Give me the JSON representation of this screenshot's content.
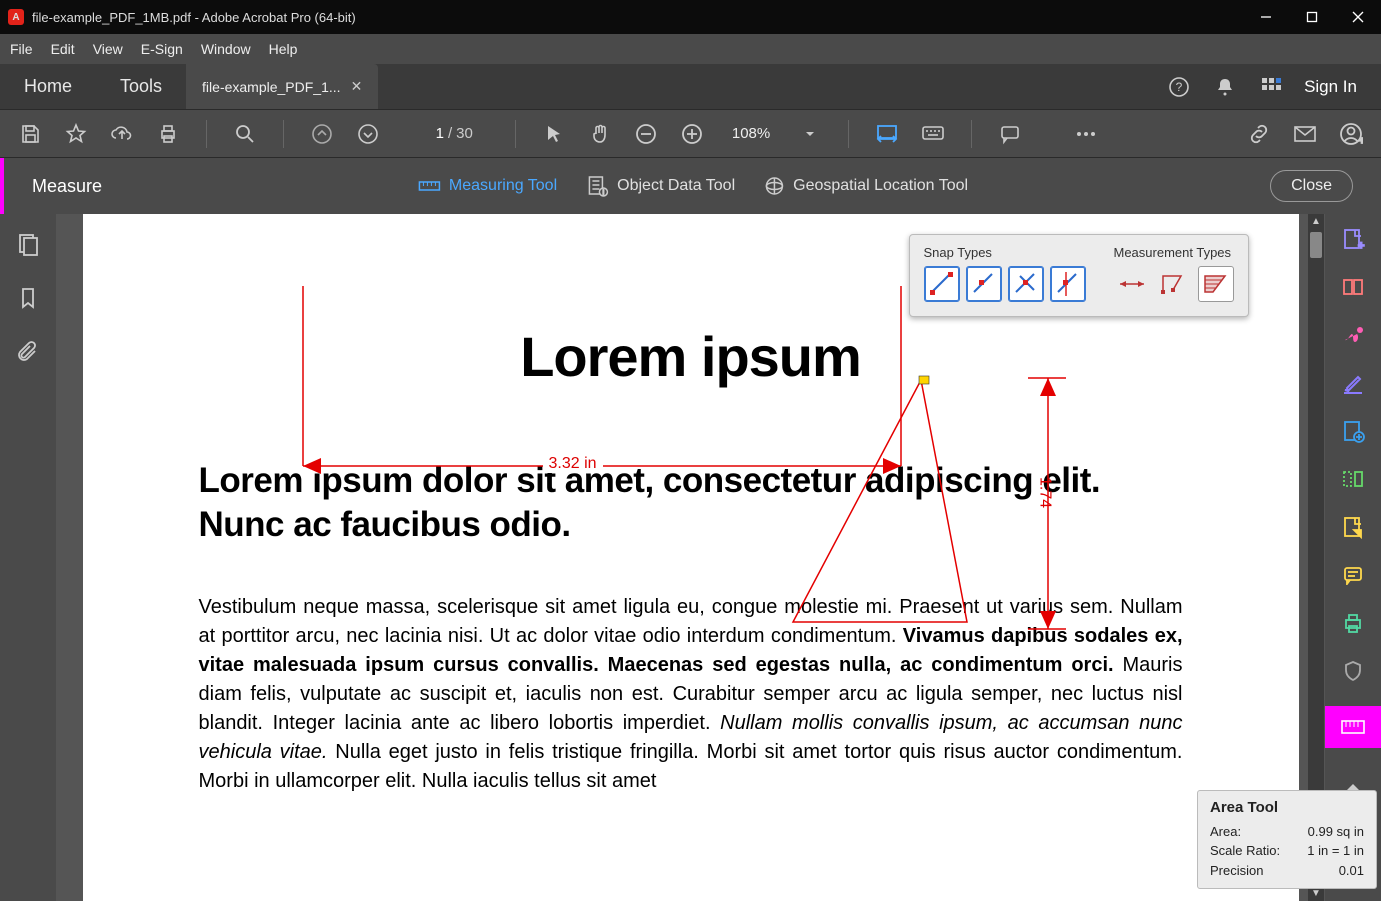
{
  "titlebar": {
    "title": "file-example_PDF_1MB.pdf - Adobe Acrobat Pro (64-bit)"
  },
  "menubar": [
    "File",
    "Edit",
    "View",
    "E-Sign",
    "Window",
    "Help"
  ],
  "tabs": {
    "home": "Home",
    "tools": "Tools",
    "doc": "file-example_PDF_1..."
  },
  "signin": "Sign In",
  "toolbar": {
    "page_current": "1",
    "page_sep": "/",
    "page_total": "30",
    "zoom": "108%"
  },
  "measure_bar": {
    "title": "Measure",
    "measuring": "Measuring Tool",
    "object_data": "Object Data Tool",
    "geospatial": "Geospatial Location Tool",
    "close": "Close"
  },
  "snap_panel": {
    "snap_title": "Snap Types",
    "meas_title": "Measurement Types"
  },
  "doc": {
    "h1": "Lorem ipsum",
    "h2": "Lorem ipsum dolor sit amet, consectetur adipiscing elit. Nunc ac faucibus odio.",
    "p1a": "Vestibulum neque massa, scelerisque sit amet ligula eu, congue molestie mi. Praesent ut varius sem. Nullam at porttitor arcu, nec lacinia nisi. Ut ac dolor vitae odio interdum condimentum. ",
    "p1b": "Vivamus dapibus sodales ex, vitae malesuada ipsum cursus convallis. Maecenas sed egestas nulla, ac condimentum orci.",
    "p1c": " Mauris diam felis, vulputate ac suscipit et, iaculis non est. Curabitur semper arcu ac ligula semper, nec luctus nisl blandit. Integer lacinia ante ac libero lobortis imperdiet. ",
    "p1d": "Nullam mollis convallis ipsum, ac accumsan nunc vehicula vitae.",
    "p1e": " Nulla eget justo in felis tristique fringilla. Morbi sit amet tortor quis risus auctor condimentum. Morbi in ullamcorper elit. Nulla iaculis tellus sit amet"
  },
  "dims": {
    "h": "3.32 in",
    "v": "1.74"
  },
  "area_tool": {
    "title": "Area Tool",
    "area_label": "Area:",
    "area_val": "0.99 sq in",
    "scale_label": "Scale Ratio:",
    "scale_val": "1 in = 1 in",
    "prec_label": "Precision",
    "prec_val": "0.01"
  }
}
